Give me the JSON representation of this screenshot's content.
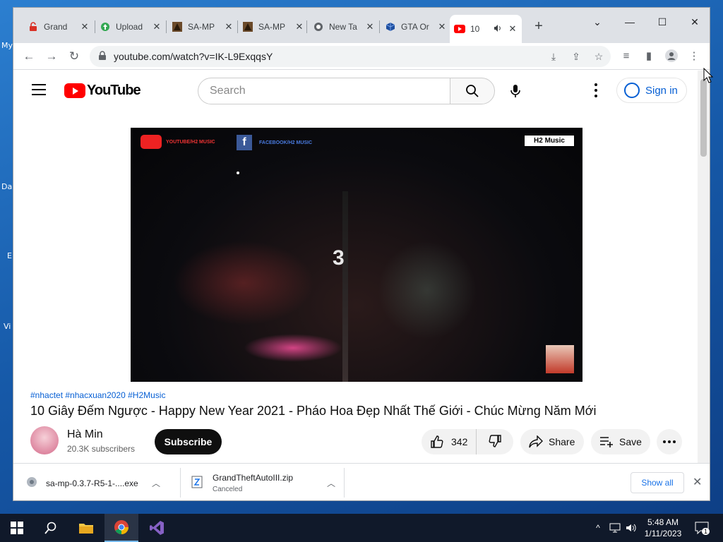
{
  "desktop": {
    "labels": [
      "My",
      "Da",
      "E",
      "Vi"
    ]
  },
  "browser": {
    "tabs": [
      {
        "label": "Grand",
        "icon": "lock-red-icon"
      },
      {
        "label": "Upload",
        "icon": "upload-icon"
      },
      {
        "label": "SA-MP",
        "icon": "samp-icon"
      },
      {
        "label": "SA-MP",
        "icon": "samp-icon"
      },
      {
        "label": "New Ta",
        "icon": "github-icon"
      },
      {
        "label": "GTA Or",
        "icon": "cube-icon"
      },
      {
        "label": "10",
        "icon": "youtube-icon",
        "active": true
      }
    ],
    "url": "youtube.com/watch?v=IK-L9ExqqsY"
  },
  "youtube": {
    "logo_text": "YouTube",
    "search_placeholder": "Search",
    "sign_in": "Sign in",
    "player_overlay": {
      "youtube_text": "YOUTUBE/H2 MUSIC",
      "facebook_text": "FACEBOOK/H2 MUSIC",
      "badge": "H2 Music",
      "digit": "3"
    },
    "hashtags": "#nhactet #nhacxuan2020 #H2Music",
    "title": "10 Giây Đếm Ngược - Happy New Year 2021 - Pháo Hoa Đẹp Nhất Thế Giới - Chúc Mừng Năm Mới",
    "channel": "Hà Min",
    "subscribers": "20.3K subscribers",
    "subscribe": "Subscribe",
    "likes": "342",
    "share": "Share",
    "save": "Save"
  },
  "downloads": [
    {
      "name": "sa-mp-0.3.7-R5-1-....exe",
      "status": ""
    },
    {
      "name": "GrandTheftAutoIII.zip",
      "status": "Canceled"
    }
  ],
  "show_all": "Show all",
  "taskbar": {
    "time": "5:48 AM",
    "date": "1/11/2023",
    "notifications": "1"
  }
}
